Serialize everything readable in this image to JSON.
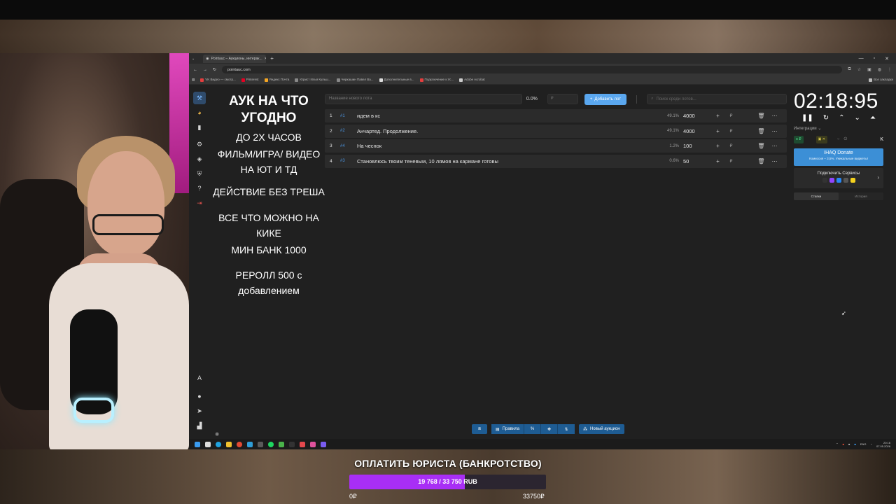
{
  "browser": {
    "tab_title": "Pointauc – Аукционы, интерак...",
    "url": "pointauc.com",
    "bookmarks": [
      {
        "label": "VK Видео — смотр...",
        "color": "#e43e3e"
      },
      {
        "label": "Pinterest",
        "color": "#e60023"
      },
      {
        "label": "Яндекс Почта",
        "color": "#f5a623"
      },
      {
        "label": "Юрист Илья Кульш...",
        "color": "#888888"
      },
      {
        "label": "Черкашин Павел Ва...",
        "color": "#888888"
      },
      {
        "label": "Дополнительные в...",
        "color": "#dddddd"
      },
      {
        "label": "Подключение к Ус...",
        "color": "#e43e3e"
      },
      {
        "label": "Adobe Acrobat",
        "color": "#cccccc"
      }
    ],
    "all_bookmarks": "Все закладки"
  },
  "promo": {
    "lines": [
      "АУК НА ЧТО УГОДНО",
      "ДО 2Х ЧАСОВ",
      "ФИЛЬМ/ИГРА/ ВИДЕО НА ЮТ И ТД",
      "ДЕЙСТВИЕ БЕЗ ТРЕША",
      "ВСЕ ЧТО МОЖНО НА КИКЕ",
      "МИН БАНК 1000",
      "РЕРОЛЛ 500 с добавлением"
    ]
  },
  "toolbar": {
    "lot_name_placeholder": "Название нового лота",
    "percent": "0.0%",
    "amount_placeholder": "₽",
    "add_lot_label": "Добавить лот",
    "search_placeholder": "Поиск среди лотов..."
  },
  "lots": [
    {
      "num": "1",
      "id": "#1",
      "name": "идем в кс",
      "pct": "49.1%",
      "amount": "4000"
    },
    {
      "num": "2",
      "id": "#2",
      "name": "Анчартед. Продолжение.",
      "pct": "49.1%",
      "amount": "4000"
    },
    {
      "num": "3",
      "id": "#4",
      "name": "На чеснок",
      "pct": "1.2%",
      "amount": "100"
    },
    {
      "num": "4",
      "id": "#3",
      "name": "Становлюсь твоим теневым, 10 лямов на кармане готовы",
      "pct": "0.6%",
      "amount": "50"
    }
  ],
  "side": {
    "timer": "02:18:95",
    "integrations_label": "Интеграции",
    "donate_title": "IHAQ Donate",
    "donate_sub": "Комиссия – 3,5%. Уникальные виджеты!",
    "connect_label": "Подключить Сервисы",
    "tab_bids": "Ставки",
    "tab_history": "История"
  },
  "bottom_bar": {
    "rules_label": "Правила",
    "percent_symbol": "%",
    "new_auction_label": "Новый аукцион"
  },
  "taskbar": {
    "lang": "ENG",
    "time": "20:16",
    "date": "07.05.2026"
  },
  "goal": {
    "title": "ОПЛАТИТЬ ЮРИСТА (БАНКРОТСТВО)",
    "progress_text": "19 768 / 33 750 RUB",
    "progress_fraction": 0.5857,
    "min_label": "0₽",
    "max_label": "33750₽",
    "fill_color": "#a82ef5"
  }
}
